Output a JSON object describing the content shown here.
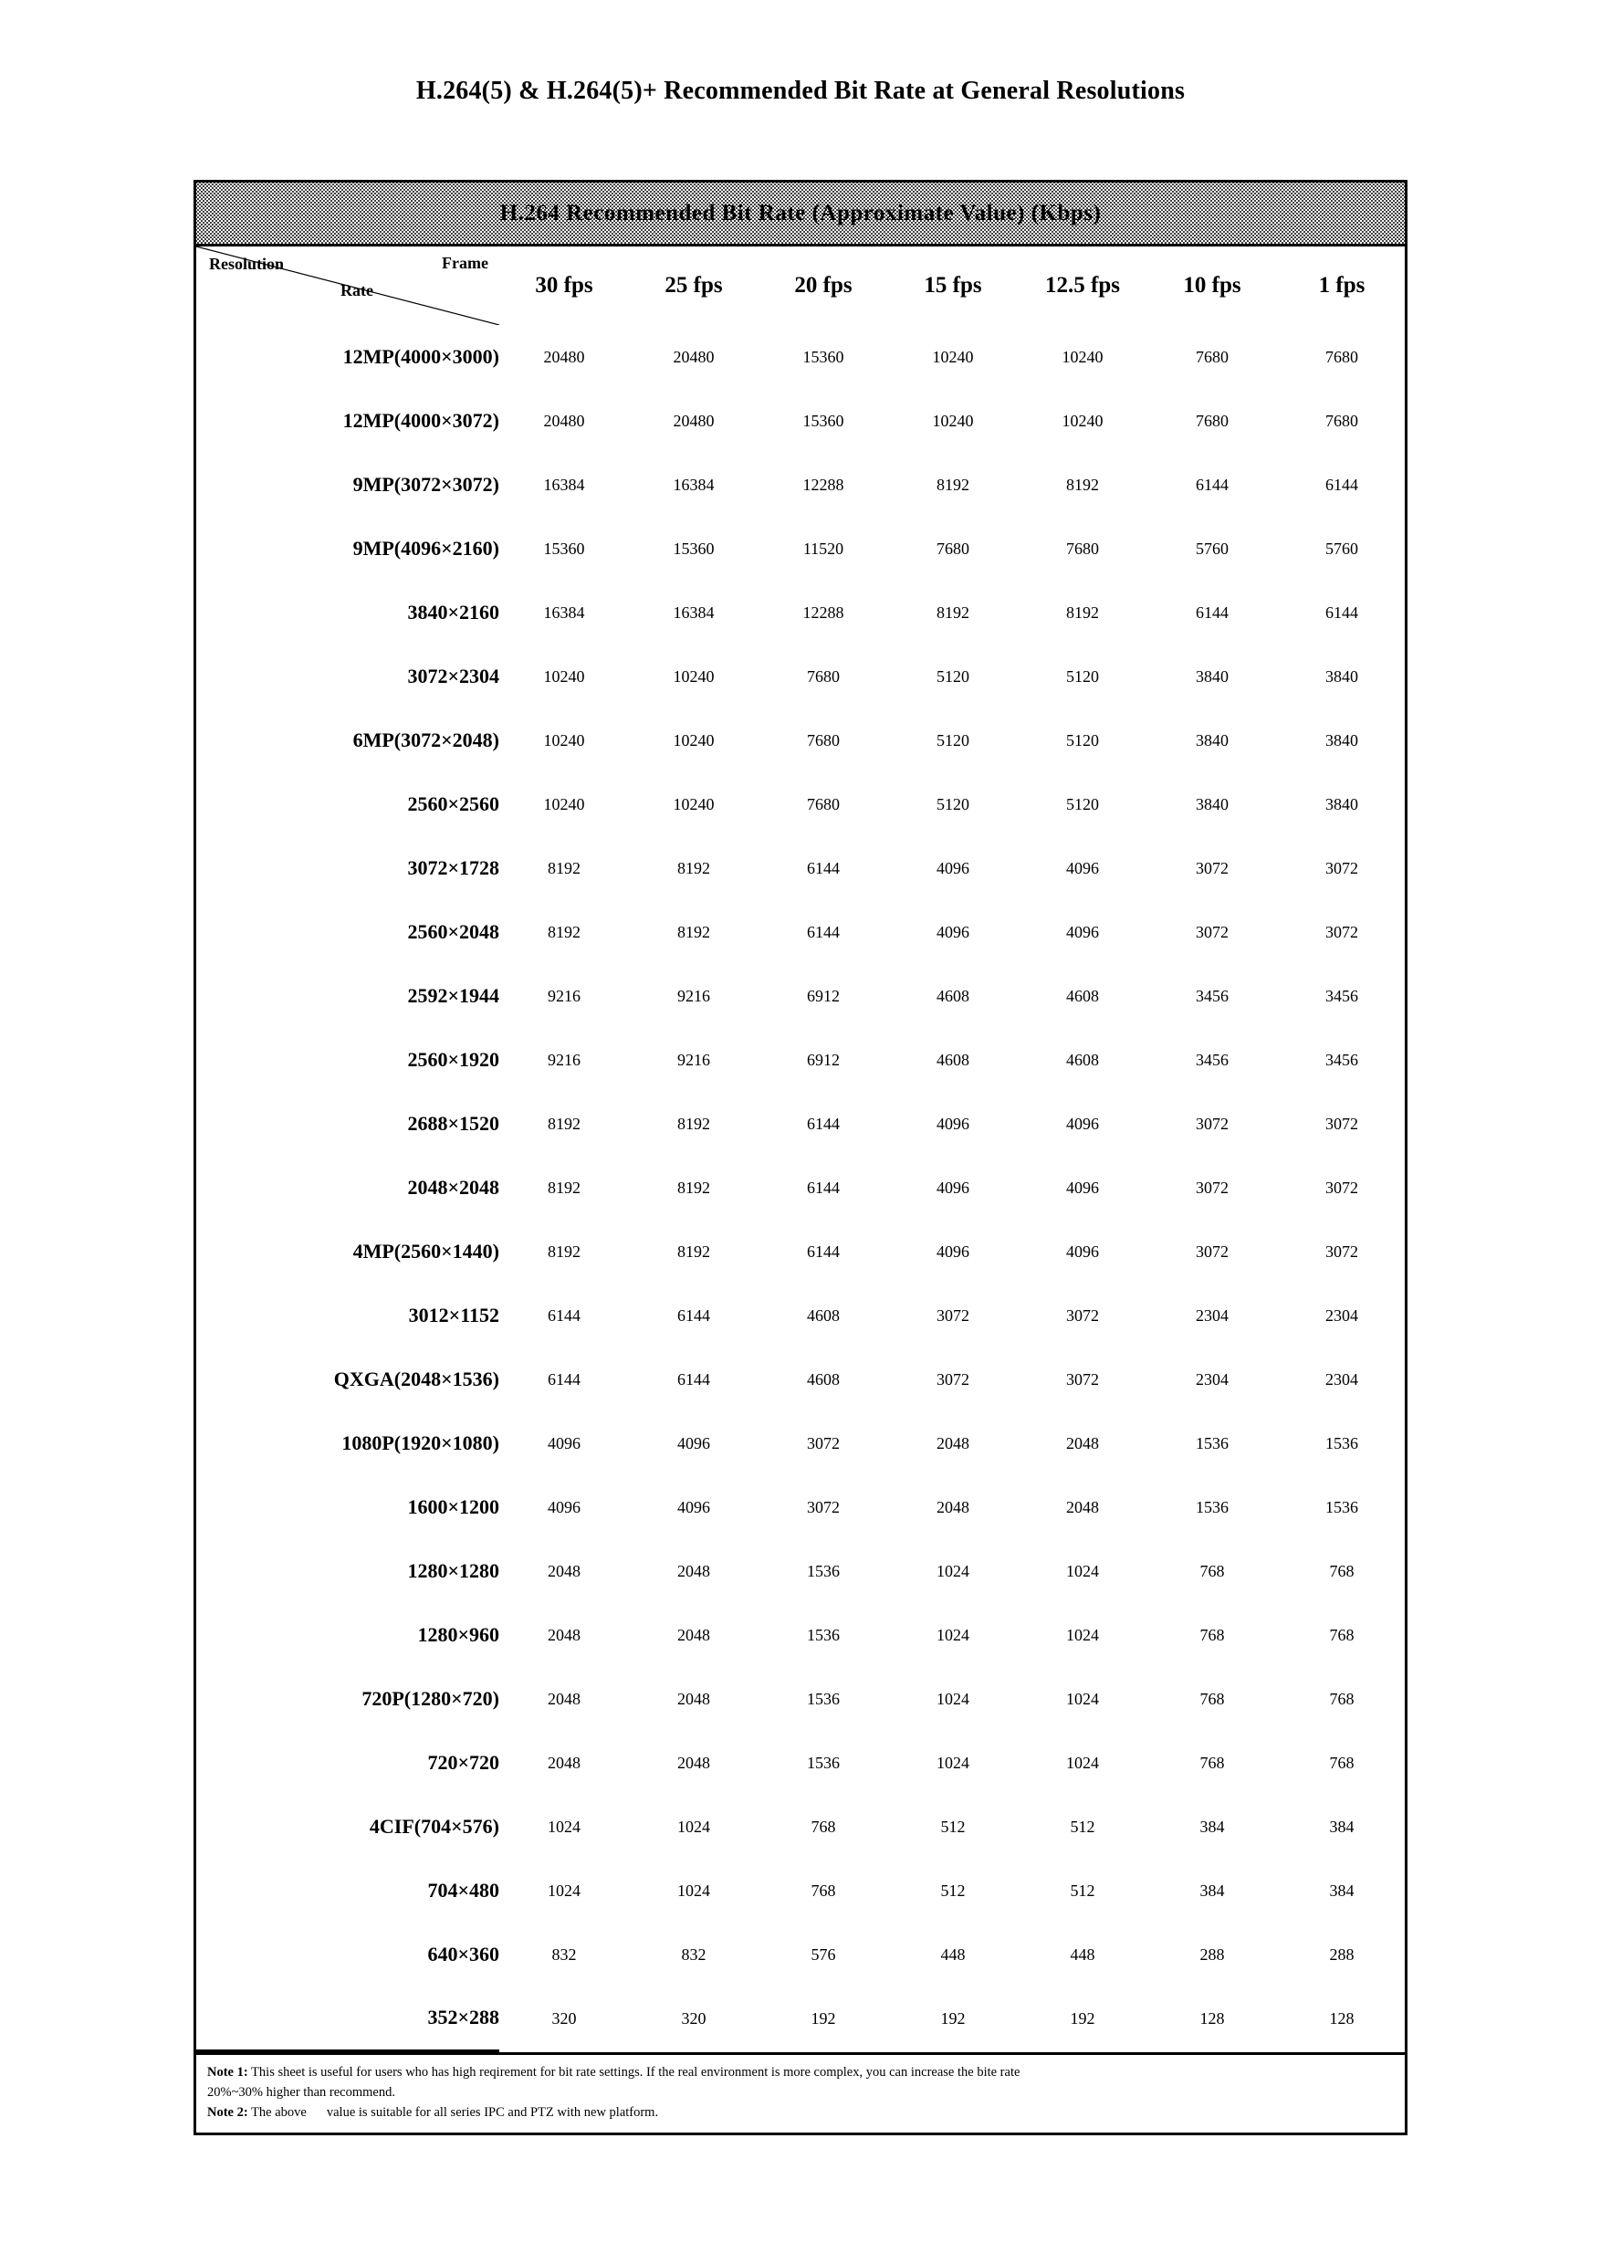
{
  "document": {
    "title": "H.264(5) & H.264(5)+ Recommended Bit Rate at General Resolutions"
  },
  "table": {
    "banner": "H.264 Recommended Bit Rate (Approximate Value) (Kbps)",
    "corner": {
      "row_axis_label": "Resolution",
      "col_axis_label_top": "Frame",
      "col_axis_label_bottom": "Rate"
    },
    "columns": [
      "30 fps",
      "25 fps",
      "20 fps",
      "15 fps",
      "12.5 fps",
      "10 fps",
      "1 fps"
    ],
    "rows": [
      {
        "resolution": "12MP(4000×3000)",
        "values": [
          "20480",
          "20480",
          "15360",
          "10240",
          "10240",
          "7680",
          "7680"
        ]
      },
      {
        "resolution": "12MP(4000×3072)",
        "values": [
          "20480",
          "20480",
          "15360",
          "10240",
          "10240",
          "7680",
          "7680"
        ]
      },
      {
        "resolution": "9MP(3072×3072)",
        "values": [
          "16384",
          "16384",
          "12288",
          "8192",
          "8192",
          "6144",
          "6144"
        ]
      },
      {
        "resolution": "9MP(4096×2160)",
        "values": [
          "15360",
          "15360",
          "11520",
          "7680",
          "7680",
          "5760",
          "5760"
        ]
      },
      {
        "resolution": "3840×2160",
        "values": [
          "16384",
          "16384",
          "12288",
          "8192",
          "8192",
          "6144",
          "6144"
        ]
      },
      {
        "resolution": "3072×2304",
        "values": [
          "10240",
          "10240",
          "7680",
          "5120",
          "5120",
          "3840",
          "3840"
        ]
      },
      {
        "resolution": "6MP(3072×2048)",
        "values": [
          "10240",
          "10240",
          "7680",
          "5120",
          "5120",
          "3840",
          "3840"
        ]
      },
      {
        "resolution": "2560×2560",
        "values": [
          "10240",
          "10240",
          "7680",
          "5120",
          "5120",
          "3840",
          "3840"
        ]
      },
      {
        "resolution": "3072×1728",
        "values": [
          "8192",
          "8192",
          "6144",
          "4096",
          "4096",
          "3072",
          "3072"
        ]
      },
      {
        "resolution": "2560×2048",
        "values": [
          "8192",
          "8192",
          "6144",
          "4096",
          "4096",
          "3072",
          "3072"
        ]
      },
      {
        "resolution": "2592×1944",
        "values": [
          "9216",
          "9216",
          "6912",
          "4608",
          "4608",
          "3456",
          "3456"
        ]
      },
      {
        "resolution": "2560×1920",
        "values": [
          "9216",
          "9216",
          "6912",
          "4608",
          "4608",
          "3456",
          "3456"
        ]
      },
      {
        "resolution": "2688×1520",
        "values": [
          "8192",
          "8192",
          "6144",
          "4096",
          "4096",
          "3072",
          "3072"
        ]
      },
      {
        "resolution": "2048×2048",
        "values": [
          "8192",
          "8192",
          "6144",
          "4096",
          "4096",
          "3072",
          "3072"
        ]
      },
      {
        "resolution": "4MP(2560×1440)",
        "values": [
          "8192",
          "8192",
          "6144",
          "4096",
          "4096",
          "3072",
          "3072"
        ]
      },
      {
        "resolution": "3012×1152",
        "values": [
          "6144",
          "6144",
          "4608",
          "3072",
          "3072",
          "2304",
          "2304"
        ]
      },
      {
        "resolution": "QXGA(2048×1536)",
        "values": [
          "6144",
          "6144",
          "4608",
          "3072",
          "3072",
          "2304",
          "2304"
        ]
      },
      {
        "resolution": "1080P(1920×1080)",
        "values": [
          "4096",
          "4096",
          "3072",
          "2048",
          "2048",
          "1536",
          "1536"
        ]
      },
      {
        "resolution": "1600×1200",
        "values": [
          "4096",
          "4096",
          "3072",
          "2048",
          "2048",
          "1536",
          "1536"
        ]
      },
      {
        "resolution": "1280×1280",
        "values": [
          "2048",
          "2048",
          "1536",
          "1024",
          "1024",
          "768",
          "768"
        ]
      },
      {
        "resolution": "1280×960",
        "values": [
          "2048",
          "2048",
          "1536",
          "1024",
          "1024",
          "768",
          "768"
        ]
      },
      {
        "resolution": "720P(1280×720)",
        "values": [
          "2048",
          "2048",
          "1536",
          "1024",
          "1024",
          "768",
          "768"
        ]
      },
      {
        "resolution": "720×720",
        "values": [
          "2048",
          "2048",
          "1536",
          "1024",
          "1024",
          "768",
          "768"
        ]
      },
      {
        "resolution": "4CIF(704×576)",
        "values": [
          "1024",
          "1024",
          "768",
          "512",
          "512",
          "384",
          "384"
        ]
      },
      {
        "resolution": "704×480",
        "values": [
          "1024",
          "1024",
          "768",
          "512",
          "512",
          "384",
          "384"
        ]
      },
      {
        "resolution": "640×360",
        "values": [
          "832",
          "832",
          "576",
          "448",
          "448",
          "288",
          "288"
        ]
      },
      {
        "resolution": "352×288",
        "values": [
          "320",
          "320",
          "192",
          "192",
          "192",
          "128",
          "128"
        ]
      }
    ]
  },
  "notes": {
    "note1_label": "Note 1:",
    "note1_line1": " This sheet is useful for users who has high reqirement for bit rate settings. If the real environment is more complex, you can increase the bite rate",
    "note1_line2": "20%~30% higher than recommend.",
    "note2_label": "Note 2:",
    "note2_text_a": " The above",
    "note2_text_b": "value is suitable for all series IPC and PTZ with new platform."
  },
  "colors": {
    "text": "#000000",
    "border": "#000000",
    "banner_pattern": "#000000",
    "background": "#ffffff"
  }
}
